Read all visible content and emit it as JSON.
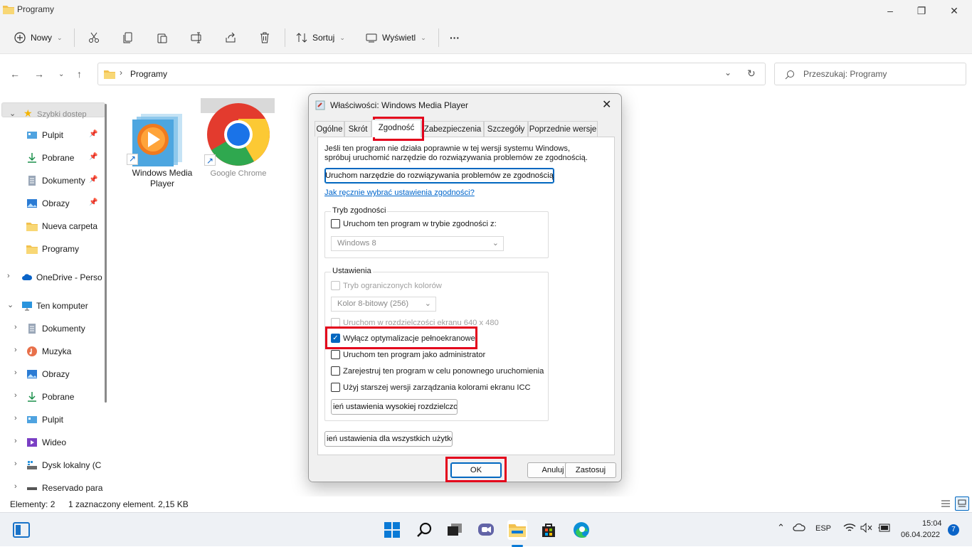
{
  "window": {
    "title": "Programy"
  },
  "toolbar": {
    "new": "Nowy",
    "sort": "Sortuj",
    "view": "Wyświetl",
    "more": "···"
  },
  "address": {
    "path": "Programy",
    "search_placeholder": "Przeszukaj: Programy"
  },
  "sidebar": {
    "quick_access": "Szybki dostep",
    "items": [
      "Pulpit",
      "Pobrane",
      "Dokumenty",
      "Obrazy",
      "Nueva carpeta",
      "Programy"
    ],
    "onedrive": "OneDrive - Perso",
    "this_pc": "Ten komputer",
    "pc_items": [
      "Dokumenty",
      "Muzyka",
      "Obrazy",
      "Pobrane",
      "Pulpit",
      "Wideo",
      "Dysk lokalny (C",
      "Reservado para"
    ]
  },
  "files": [
    {
      "name": "Windows Media Player"
    },
    {
      "name": "Google Chrome"
    }
  ],
  "status": {
    "count": "Elementy: 2",
    "selected": "1 zaznaczony element. 2,15 KB"
  },
  "dialog": {
    "title": "Właściwości: Windows Media Player",
    "tabs": [
      "Ogólne",
      "Skrót",
      "Zgodność",
      "Zabezpieczenia",
      "Szczegóły",
      "Poprzednie wersje"
    ],
    "intro_line1": "Jeśli ten program nie działa poprawnie w tej wersji systemu Windows,",
    "intro_line2": "spróbuj uruchomić narzędzie do rozwiązywania problemów ze zgodnością.",
    "troubleshoot_button": "Uruchom narzędzie do rozwiązywania problemów ze zgodnością",
    "manual_link": "Jak ręcznie wybrać ustawienia zgodności?",
    "compat_group": "Tryb zgodności",
    "compat_check": "Uruchom ten program w trybie zgodności z:",
    "compat_select": "Windows 8",
    "settings_group": "Ustawienia",
    "reduced_color": "Tryb ograniczonych kolorów",
    "color_select": "Kolor 8-bitowy (256)",
    "res_640": "Uruchom w rozdzielczości ekranu 640 x 480",
    "disable_fullscreen": "Wyłącz optymalizacje pełnoekranowe",
    "run_admin": "Uruchom ten program jako administrator",
    "register_restart": "Zarejestruj ten program w celu ponownego uruchomienia",
    "legacy_icc": "Użyj starszej wersji zarządzania kolorami ekranu ICC",
    "high_dpi_button": "ień ustawienia wysokiej rozdzielczości",
    "all_users_button": "ień ustawienia dla wszystkich użytkow",
    "ok": "OK",
    "cancel": "Anuluj",
    "apply": "Zastosuj"
  },
  "tray": {
    "lang": "ESP",
    "time": "15:04",
    "date": "06.04.2022",
    "badge": "7"
  }
}
